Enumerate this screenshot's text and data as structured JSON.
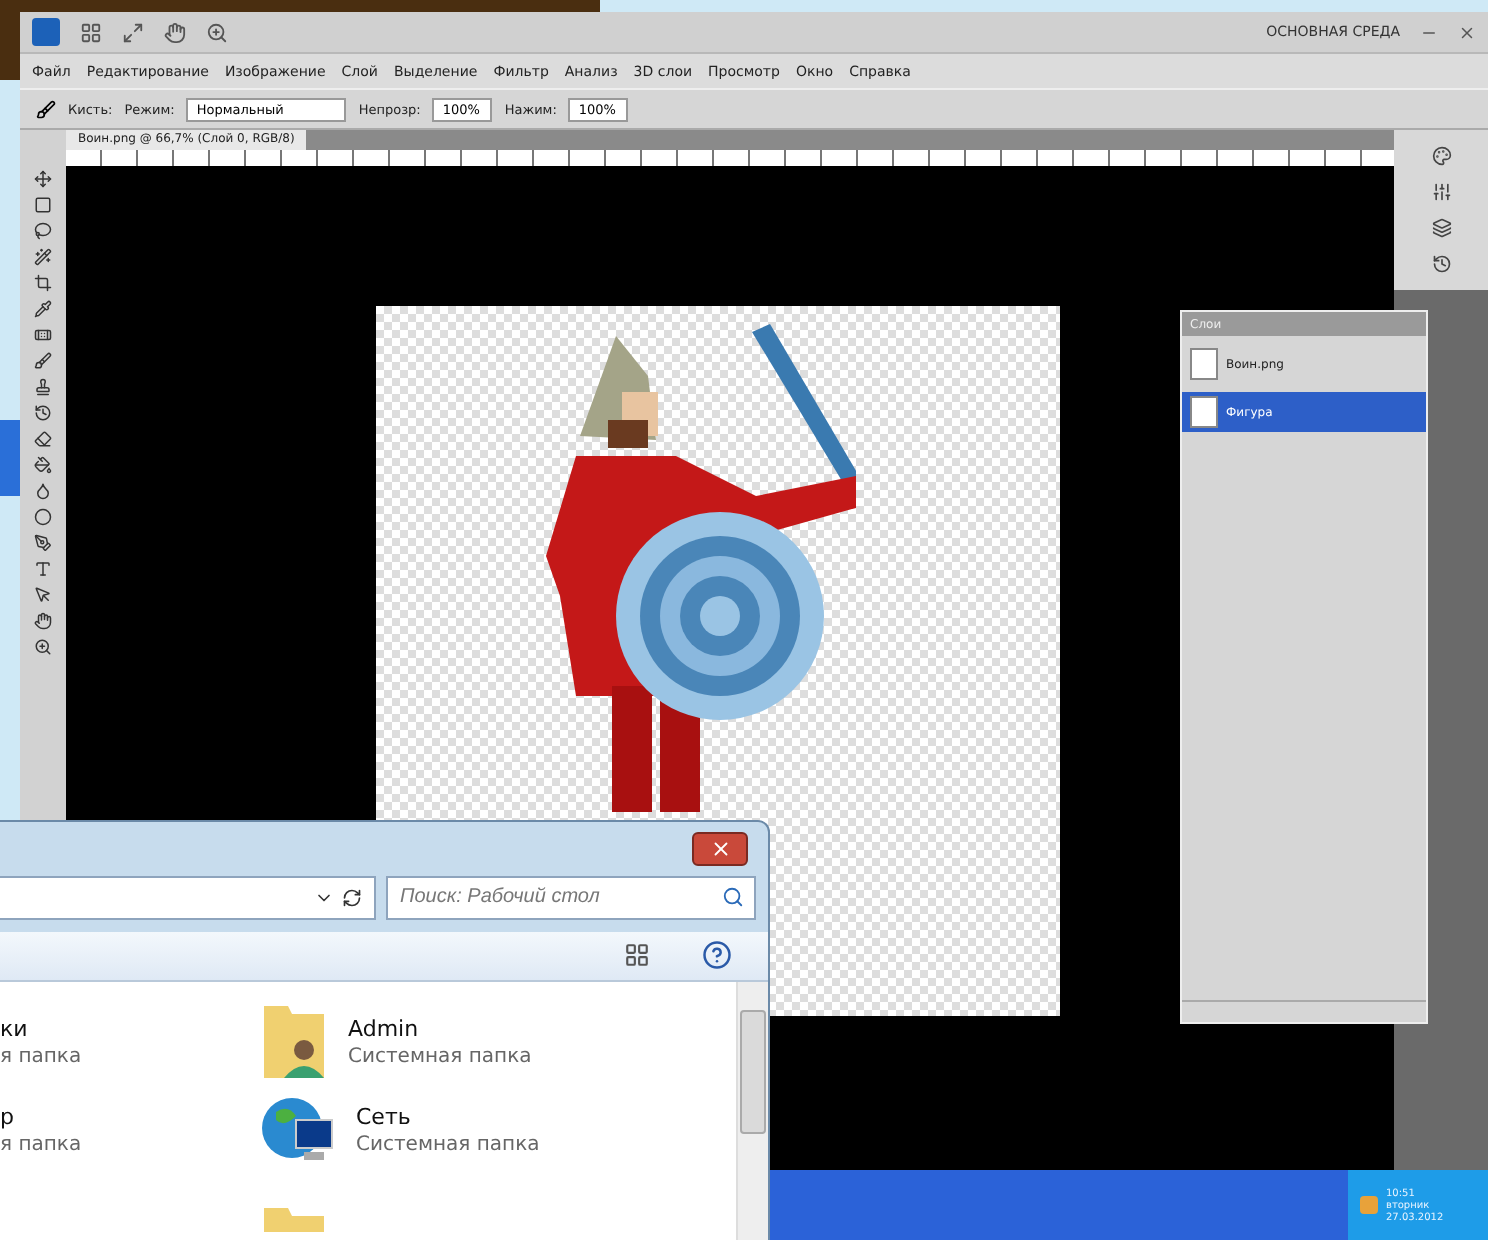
{
  "photoshop": {
    "workspace": "ОСНОВНАЯ СРЕДА",
    "menu": [
      "Файл",
      "Редактирование",
      "Изображение",
      "Слой",
      "Выделение",
      "Фильтр",
      "Анализ",
      "3D слои",
      "Просмотр",
      "Окно",
      "Справка"
    ],
    "options": {
      "brush_label": "Кисть:",
      "mode_label": "Режим:",
      "mode_value": "Нормальный",
      "opacity_label": "Непрозр:",
      "opacity_value": "100%",
      "flow_label": "Нажим:",
      "flow_value": "100%"
    },
    "document_tab": "Воин.png @ 66,7% (Слой 0, RGB/8)",
    "layers_panel": {
      "title": "Слои",
      "layers": [
        {
          "name": "Воин.png",
          "selected": false
        },
        {
          "name": "Фигура",
          "selected": true
        }
      ]
    }
  },
  "explorer": {
    "search": {
      "placeholder": "Поиск: Рабочий стол"
    },
    "items": [
      {
        "kind": "cut",
        "name": "ки",
        "subtitle": "я папка"
      },
      {
        "kind": "user",
        "name": "Admin",
        "subtitle": "Системная папка"
      },
      {
        "kind": "cut",
        "name": "р",
        "subtitle": "я папка"
      },
      {
        "kind": "network",
        "name": "Сеть",
        "subtitle": "Системная папка"
      },
      {
        "kind": "none"
      },
      {
        "kind": "folder"
      }
    ]
  },
  "taskbar": {
    "clock": [
      "10:51",
      "вторник",
      "27.03.2012"
    ]
  }
}
